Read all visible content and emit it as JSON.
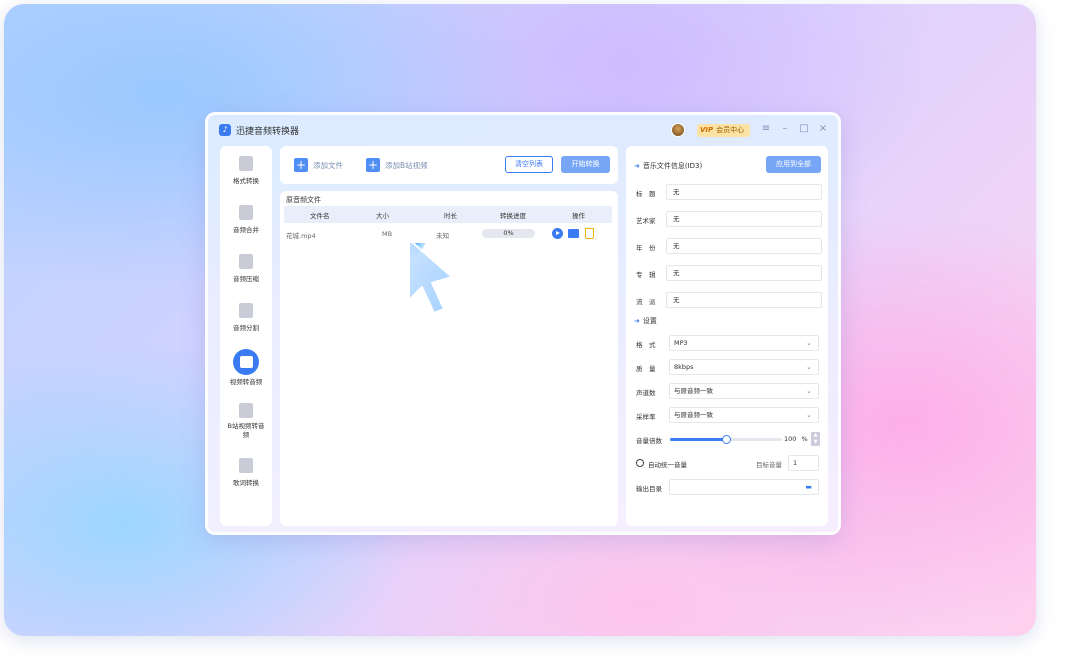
{
  "app": {
    "title": "迅捷音频转换器",
    "vip_tag": "VIP",
    "vip_label": "会员中心"
  },
  "window_controls": [
    "≡",
    "–",
    "□",
    "×"
  ],
  "sidebar": {
    "items": [
      {
        "label": "格式转换",
        "icon": "format-convert-icon"
      },
      {
        "label": "音频合并",
        "icon": "audio-merge-icon"
      },
      {
        "label": "音频压缩",
        "icon": "audio-compress-icon"
      },
      {
        "label": "音频分割",
        "icon": "audio-split-icon"
      },
      {
        "label": "视频转音频",
        "icon": "video-to-audio-icon",
        "active": true
      },
      {
        "label": "B站视频转音频",
        "icon": "bilibili-video-icon"
      },
      {
        "label": "歌词转换",
        "icon": "lyrics-convert-icon"
      }
    ]
  },
  "toolbar": {
    "add_file": "添加文件",
    "add_bilibili": "添加B站视频",
    "clear_list": "清空列表",
    "start_convert": "开始转换"
  },
  "file_list": {
    "title": "原音频文件",
    "columns": [
      "文件名",
      "大小",
      "时长",
      "转换进度",
      "操作"
    ],
    "rows": [
      {
        "name": "花城.mp4",
        "size": "MB",
        "duration": "未知",
        "progress": "0%"
      }
    ]
  },
  "right_panel": {
    "metadata_title": "音乐文件信息(ID3)",
    "apply_all": "应用到全部",
    "metadata": [
      {
        "label": "标　题",
        "value": "无"
      },
      {
        "label": "艺术家",
        "value": "无"
      },
      {
        "label": "年　份",
        "value": "无"
      },
      {
        "label": "专　辑",
        "value": "无"
      },
      {
        "label": "流　派",
        "value": "无"
      }
    ],
    "settings_title": "设置",
    "settings": [
      {
        "label": "格　式",
        "value": "MP3"
      },
      {
        "label": "质　量",
        "value": "8kbps"
      },
      {
        "label": "声道数",
        "value": "与原音频一致"
      },
      {
        "label": "采样率",
        "value": "与原音频一致"
      }
    ],
    "volume_label": "音量倍数",
    "volume_value": "100",
    "volume_unit": "%",
    "volume_fraction": 0.5,
    "auto_volume_label": "自动统一音量",
    "target_volume_label": "目标音量",
    "target_volume_value": "1",
    "output_dir_label": "输出目录"
  },
  "colors": {
    "accent": "#3b7bf2",
    "button_primary": "#77a6f6",
    "vip_bg": "#fbe3a3"
  }
}
